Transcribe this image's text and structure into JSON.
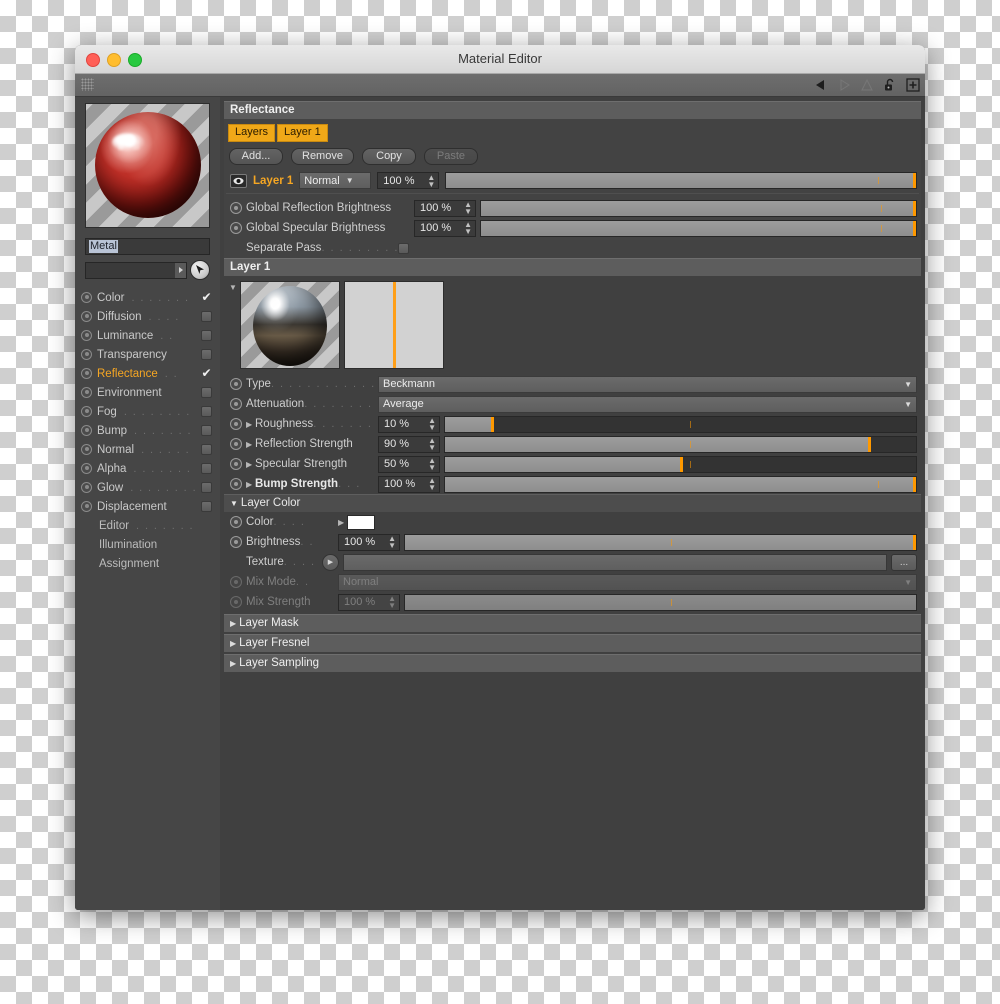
{
  "window": {
    "title": "Material Editor",
    "traffic_lights": [
      "close-button",
      "minimize-button",
      "maximize-button"
    ],
    "toolbar_icons": [
      "back-arrow-icon",
      "forward-arrow-icon",
      "up-arrow-icon",
      "lock-open-icon",
      "add-box-icon"
    ]
  },
  "sidebar": {
    "material_name": "Metal",
    "channels": [
      {
        "label": "Color",
        "dots": ". . . . . . .",
        "checked": true,
        "active": false
      },
      {
        "label": "Diffusion",
        "dots": ". . . .",
        "checked": false,
        "active": false
      },
      {
        "label": "Luminance",
        "dots": ". .",
        "checked": false,
        "active": false
      },
      {
        "label": "Transparency",
        "dots": "",
        "checked": false,
        "active": false
      },
      {
        "label": "Reflectance",
        "dots": ". .",
        "checked": true,
        "active": true
      },
      {
        "label": "Environment",
        "dots": "",
        "checked": false,
        "active": false
      },
      {
        "label": "Fog",
        "dots": ". . . . . . . . .",
        "checked": false,
        "active": false
      },
      {
        "label": "Bump",
        "dots": ". . . . . . .",
        "checked": false,
        "active": false
      },
      {
        "label": "Normal",
        "dots": ". . . . . .",
        "checked": false,
        "active": false
      },
      {
        "label": "Alpha",
        "dots": ". . . . . . .",
        "checked": false,
        "active": false
      },
      {
        "label": "Glow",
        "dots": ". . . . . . . .",
        "checked": false,
        "active": false
      },
      {
        "label": "Displacement",
        "dots": "",
        "checked": false,
        "active": false
      }
    ],
    "plain_items": [
      {
        "label": "Editor",
        "dots": ". . . . . . ."
      },
      {
        "label": "Illumination",
        "dots": ""
      },
      {
        "label": "Assignment",
        "dots": ""
      }
    ]
  },
  "panel": {
    "header": "Reflectance",
    "tabs": [
      {
        "label": "Layers",
        "selected": true
      },
      {
        "label": "Layer 1",
        "selected": true
      }
    ],
    "buttons": [
      {
        "label": "Add...",
        "disabled": false
      },
      {
        "label": "Remove",
        "disabled": false
      },
      {
        "label": "Copy",
        "disabled": false
      },
      {
        "label": "Paste",
        "disabled": true
      }
    ],
    "layer_row": {
      "name": "Layer 1",
      "blend_mode": "Normal",
      "opacity": "100 %",
      "opacity_pct": 100
    },
    "globals": [
      {
        "label": "Global Reflection Brightness",
        "value": "100 %",
        "pct": 100
      },
      {
        "label": "Global Specular Brightness",
        "value": "100 %",
        "pct": 100
      }
    ],
    "separate_pass": {
      "label": "Separate Pass",
      "dots": ". . . . . . . . . . . . .",
      "checked": false
    }
  },
  "layer_section": {
    "title": "Layer 1",
    "rows": [
      {
        "name": "type-row",
        "label": "Type",
        "dots": ". . . . . . . . . . . . .",
        "kind": "dropdown",
        "value": "Beckmann",
        "triangle": false,
        "bold": false
      },
      {
        "name": "attenuation-row",
        "label": "Attenuation",
        "dots": ". . . . . . . . .",
        "kind": "dropdown",
        "value": "Average",
        "triangle": false,
        "bold": false
      },
      {
        "name": "roughness-row",
        "label": "Roughness",
        "dots": ". . . . . . . .",
        "kind": "slider",
        "value": "10 %",
        "pct": 10,
        "triangle": true,
        "bold": false
      },
      {
        "name": "reflection-strength-row",
        "label": "Reflection Strength",
        "dots": "",
        "kind": "slider",
        "value": "90 %",
        "pct": 90,
        "triangle": true,
        "bold": false
      },
      {
        "name": "specular-strength-row",
        "label": "Specular Strength",
        "dots": "",
        "kind": "slider",
        "value": "50 %",
        "pct": 50,
        "triangle": true,
        "bold": false
      },
      {
        "name": "bump-strength-row",
        "label": "Bump Strength",
        "dots": ". . .",
        "kind": "slider",
        "value": "100 %",
        "pct": 100,
        "triangle": true,
        "bold": true
      }
    ]
  },
  "layer_color": {
    "title": "Layer Color",
    "color_label": "Color",
    "color_dots": ". . . .",
    "color_value": "#ffffff",
    "brightness_label": "Brightness",
    "brightness_dots": ". .",
    "brightness_value": "100 %",
    "brightness_pct": 100,
    "texture_label": "Texture",
    "texture_dots": ". . . .",
    "texture_value": "",
    "texture_browse": "...",
    "mix_mode_label": "Mix Mode",
    "mix_mode_dots": ". .",
    "mix_mode_value": "Normal",
    "mix_strength_label": "Mix Strength",
    "mix_strength_dots": "",
    "mix_strength_value": "100 %",
    "mix_strength_pct": 100
  },
  "collapsed_sections": [
    {
      "label": "Layer Mask"
    },
    {
      "label": "Layer Fresnel"
    },
    {
      "label": "Layer Sampling"
    }
  ],
  "colors": {
    "accent_orange": "#f0a818",
    "slider_handle": "#ff9900",
    "panel_bg": "#404040",
    "header_bg": "#5d5d5d",
    "window_bg": "#454545"
  }
}
